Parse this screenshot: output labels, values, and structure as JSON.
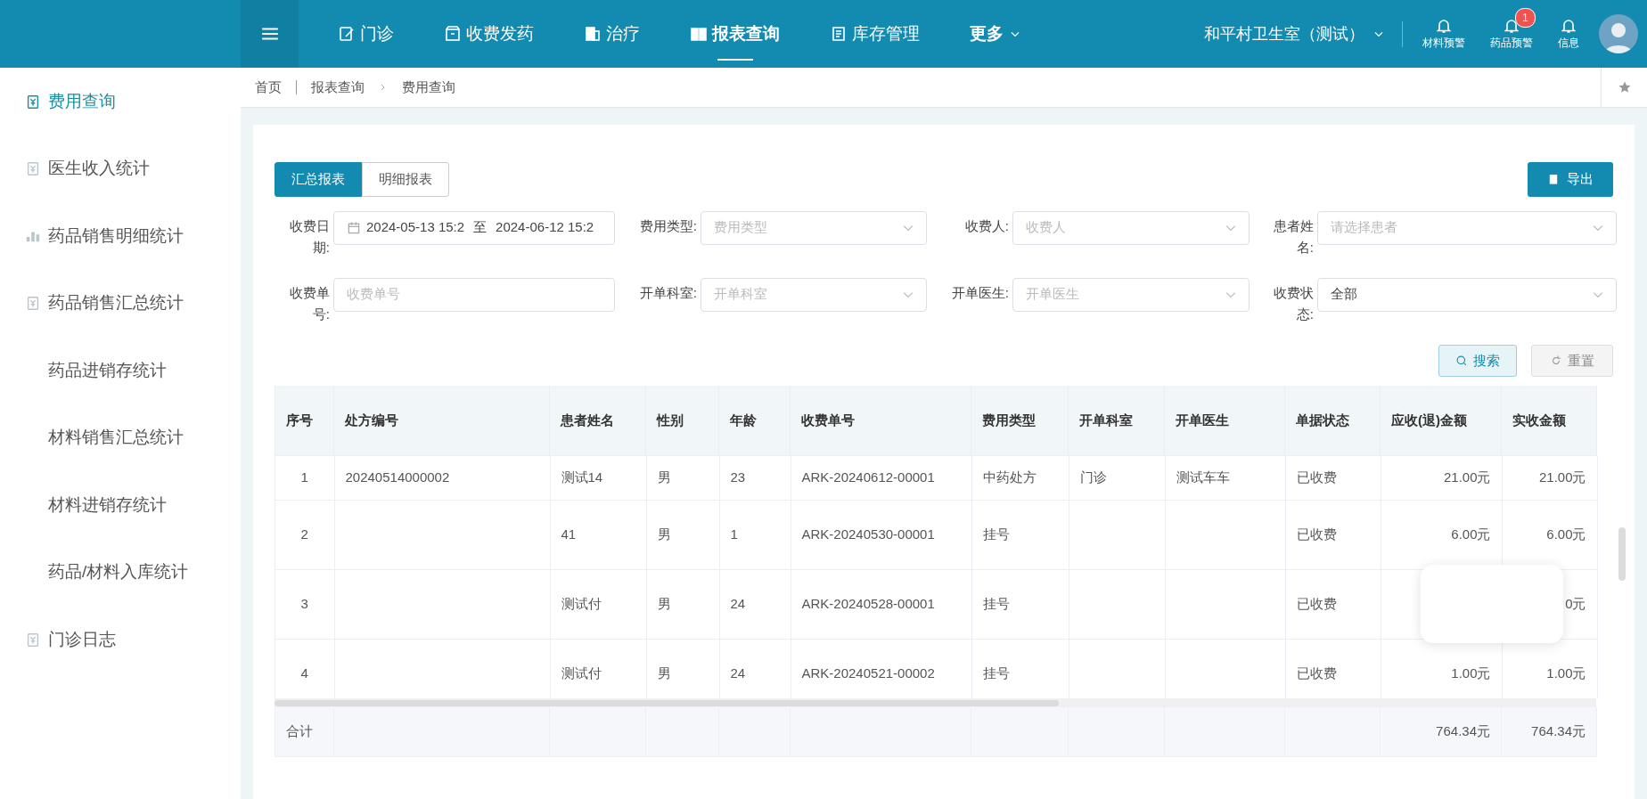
{
  "topbar": {
    "nav": [
      {
        "label": "门诊",
        "selected": false,
        "dropdown": false
      },
      {
        "label": "收费发药",
        "selected": false,
        "dropdown": false
      },
      {
        "label": "治疗",
        "selected": false,
        "dropdown": false
      },
      {
        "label": "报表查询",
        "selected": true,
        "dropdown": false
      },
      {
        "label": "库存管理",
        "selected": false,
        "dropdown": false
      },
      {
        "label": "更多",
        "selected": false,
        "dropdown": true
      }
    ],
    "clinic": "和平村卫生室（测试）",
    "alerts": [
      {
        "label": "材料预警"
      },
      {
        "label": "药品预警",
        "badge": "1"
      },
      {
        "label": "信息"
      }
    ]
  },
  "sidebar": {
    "items": [
      {
        "label": "费用查询",
        "selected": true
      },
      {
        "label": "医生收入统计",
        "selected": false
      },
      {
        "label": "药品销售明细统计",
        "selected": false
      },
      {
        "label": "药品销售汇总统计",
        "selected": false
      },
      {
        "label": "药品进销存统计",
        "selected": false
      },
      {
        "label": "材料销售汇总统计",
        "selected": false
      },
      {
        "label": "材料进销存统计",
        "selected": false
      },
      {
        "label": "药品/材料入库统计",
        "selected": false
      },
      {
        "label": "门诊日志",
        "selected": false
      }
    ]
  },
  "breadcrumb": [
    "首页",
    "报表查询",
    "费用查询"
  ],
  "report_tabs": [
    {
      "label": "汇总报表",
      "selected": true
    },
    {
      "label": "明细报表",
      "selected": false
    }
  ],
  "export_button": "导出",
  "filters": [
    {
      "label": "收费日期:",
      "kind": "daterange",
      "start": "2024-05-13 15:2",
      "separator": "至",
      "end": "2024-06-12 15:2"
    },
    {
      "label": "费用类型:",
      "kind": "select",
      "placeholder": "费用类型"
    },
    {
      "label": "收费人:",
      "kind": "select",
      "placeholder": "收费人"
    },
    {
      "label": "患者姓名:",
      "kind": "select",
      "placeholder": "请选择患者"
    },
    {
      "label": "收费单号:",
      "kind": "text",
      "placeholder": "收费单号"
    },
    {
      "label": "开单科室:",
      "kind": "select",
      "placeholder": "开单科室"
    },
    {
      "label": "开单医生:",
      "kind": "select",
      "placeholder": "开单医生"
    },
    {
      "label": "收费状态:",
      "kind": "select",
      "value": "全部"
    }
  ],
  "search_button": "搜索",
  "reset_button": {
    "label": "重置",
    "disabled": true
  },
  "table": {
    "columns": [
      "序号",
      "处方编号",
      "患者姓名",
      "性别",
      "年龄",
      "收费单号",
      "费用类型",
      "开单科室",
      "开单医生",
      "单据状态",
      "应收(退)金额",
      "实收金额"
    ],
    "rows": [
      [
        "1",
        "20240514000002",
        "测试14",
        "男",
        "23",
        "ARK-20240612-00001",
        "中药处方",
        "门诊",
        "测试车车",
        "已收费",
        "21.00元",
        "21.00元"
      ],
      [
        "2",
        "",
        "41",
        "男",
        "1",
        "ARK-20240530-00001",
        "挂号",
        "",
        "",
        "已收费",
        "6.00元",
        "6.00元"
      ],
      [
        "3",
        "",
        "测试付",
        "男",
        "24",
        "ARK-20240528-00001",
        "挂号",
        "",
        "",
        "已收费",
        "",
        "0元"
      ],
      [
        "4",
        "",
        "测试付",
        "男",
        "24",
        "ARK-20240521-00002",
        "挂号",
        "",
        "",
        "已收费",
        "1.00元",
        "1.00元"
      ]
    ],
    "total": {
      "label": "合计",
      "amount_due": "764.34元",
      "amount_paid": "764.34元"
    }
  },
  "floating_card": {
    "shown": true
  }
}
